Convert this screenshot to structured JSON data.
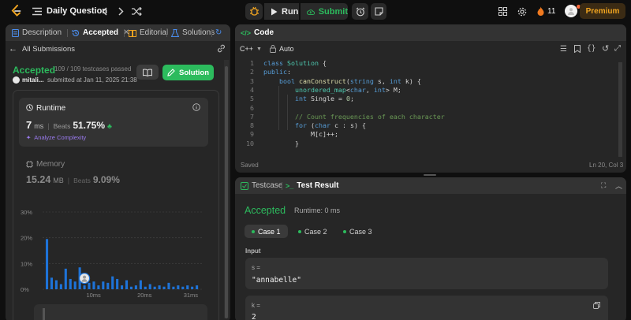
{
  "topbar": {
    "problem_list_label": "Daily Question",
    "run_label": "Run",
    "submit_label": "Submit",
    "streak_count": "11",
    "premium_label": "Premium"
  },
  "left_panel": {
    "tabs": [
      {
        "label": "Description"
      },
      {
        "label": "Accepted"
      },
      {
        "label": "Editorial"
      },
      {
        "label": "Solutions"
      }
    ],
    "back_label": "All Submissions",
    "status": "Accepted",
    "testcases": "109 / 109 testcases passed",
    "user": "mitali...",
    "submitted": "submitted at Jan 11, 2025 21:38",
    "solution_button": "Solution",
    "runtime": {
      "title": "Runtime",
      "value": "7",
      "unit": "ms",
      "beats_label": "Beats",
      "beats_value": "51.75%",
      "analyze_label": "Analyze Complexity"
    },
    "memory": {
      "title": "Memory",
      "value": "15.24",
      "unit": "MB",
      "beats_label": "Beats",
      "beats_value": "9.09%"
    }
  },
  "chart_data": {
    "type": "bar",
    "ylim": [
      0,
      30
    ],
    "yticks": [
      "30%",
      "20%",
      "10%",
      "0%"
    ],
    "xticks": [
      "10ms",
      "20ms",
      "31ms"
    ],
    "values": [
      19.5,
      4.5,
      3.5,
      2,
      8,
      4,
      3,
      8.5,
      1.5,
      2.5,
      3,
      1.5,
      3,
      2.5,
      5,
      4,
      1.5,
      3.5,
      1,
      1.5,
      3.5,
      1,
      2,
      1,
      1.5,
      1,
      2.5,
      1,
      1.5,
      1,
      1.5,
      1,
      1.5
    ],
    "highlight_index": 8,
    "bar_color": "#1e73d8"
  },
  "code_panel": {
    "title": "Code",
    "language": "C++",
    "auto_label": "Auto",
    "status_left": "Saved",
    "status_right": "Ln 20, Col 3",
    "lines": [
      {
        "n": "1",
        "text": "class Solution {"
      },
      {
        "n": "2",
        "text": "public:"
      },
      {
        "n": "3",
        "text": "    bool canConstruct(string s, int k) {"
      },
      {
        "n": "4",
        "text": "        unordered_map<char, int> M;"
      },
      {
        "n": "5",
        "text": "        int Single = 0;"
      },
      {
        "n": "6",
        "text": ""
      },
      {
        "n": "7",
        "text": "        // Count frequencies of each character"
      },
      {
        "n": "8",
        "text": "        for (char c : s) {"
      },
      {
        "n": "9",
        "text": "            M[c]++;"
      },
      {
        "n": "10",
        "text": "        }"
      }
    ]
  },
  "result_panel": {
    "testcase_tab": "Testcase",
    "result_tab": "Test Result",
    "status": "Accepted",
    "runtime": "Runtime: 0 ms",
    "cases": [
      "Case 1",
      "Case 2",
      "Case 3"
    ],
    "input_label": "Input",
    "vars": [
      {
        "name": "s =",
        "value": "\"annabelle\""
      },
      {
        "name": "k =",
        "value": "2"
      }
    ]
  }
}
